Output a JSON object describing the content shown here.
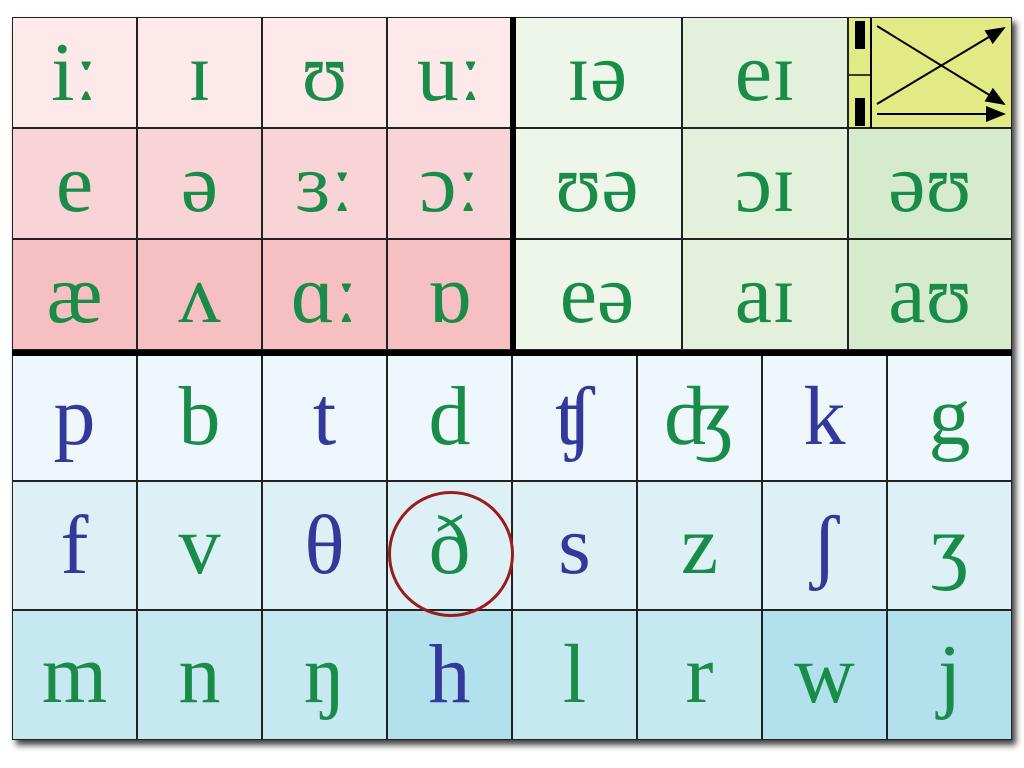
{
  "colors": {
    "voiced": "#1a8c4a",
    "voiceless": "#33399a",
    "highlight_circle": "#9b1c1c"
  },
  "monophthongs": [
    [
      "iː",
      "ɪ",
      "ʊ",
      "uː"
    ],
    [
      "e",
      "ə",
      "ɜː",
      "ɔː"
    ],
    [
      "æ",
      "ʌ",
      "ɑː",
      "ɒ"
    ]
  ],
  "diphthongs": [
    [
      "ɪə",
      "eɪ"
    ],
    [
      "ʊə",
      "ɔɪ",
      "əʊ"
    ],
    [
      "eə",
      "aɪ",
      "aʊ"
    ]
  ],
  "consonants": [
    [
      {
        "s": "p",
        "voiced": false
      },
      {
        "s": "b",
        "voiced": true
      },
      {
        "s": "t",
        "voiced": false
      },
      {
        "s": "d",
        "voiced": true
      },
      {
        "s": "ʧ",
        "voiced": false
      },
      {
        "s": "ʤ",
        "voiced": true
      },
      {
        "s": "k",
        "voiced": false
      },
      {
        "s": "g",
        "voiced": true
      }
    ],
    [
      {
        "s": "f",
        "voiced": false
      },
      {
        "s": "v",
        "voiced": true
      },
      {
        "s": "θ",
        "voiced": false
      },
      {
        "s": "ð",
        "voiced": true
      },
      {
        "s": "s",
        "voiced": false
      },
      {
        "s": "z",
        "voiced": true
      },
      {
        "s": "ʃ",
        "voiced": false
      },
      {
        "s": "ʒ",
        "voiced": true
      }
    ],
    [
      {
        "s": "m",
        "voiced": true
      },
      {
        "s": "n",
        "voiced": true
      },
      {
        "s": "ŋ",
        "voiced": true
      },
      {
        "s": "h",
        "voiced": false
      },
      {
        "s": "l",
        "voiced": true
      },
      {
        "s": "r",
        "voiced": true
      },
      {
        "s": "w",
        "voiced": true
      },
      {
        "s": "j",
        "voiced": true
      }
    ]
  ],
  "highlighted": "ð",
  "legend_icon": "intonation-arrows-icon"
}
